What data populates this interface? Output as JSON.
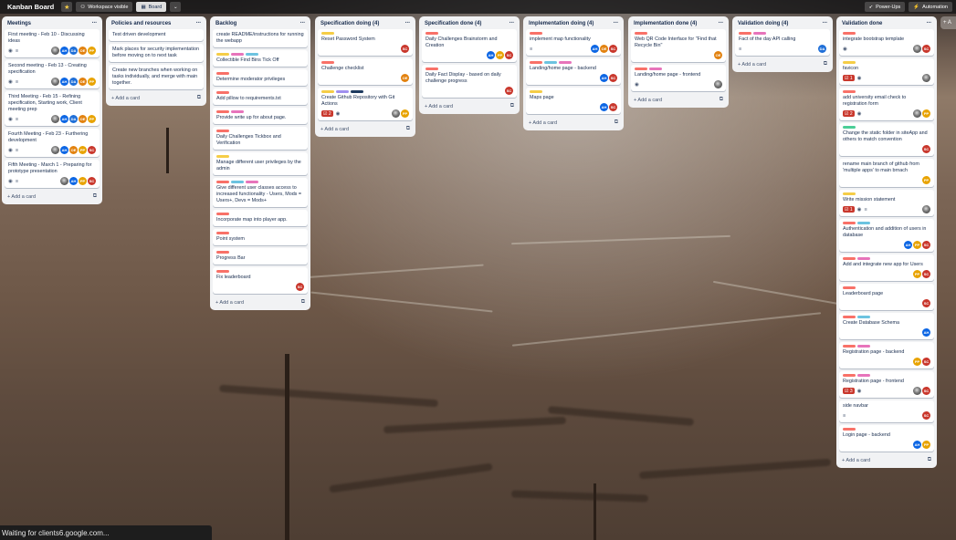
{
  "topbar": {
    "title": "Kanban Board",
    "visibility": "Workspace visible",
    "view": "Board",
    "powerups": "Power-Ups",
    "automation": "Automation"
  },
  "add_list": "+ A",
  "status_text": "Waiting for clients6.google.com...",
  "add_card_label": "+ Add a card",
  "lists": [
    {
      "title": "Meetings",
      "cards": [
        {
          "title": "First meeting - Feb 10 - Discussing ideas",
          "labels": [],
          "badges": [
            "eye",
            "desc"
          ],
          "avatars": [
            "photo",
            "AH",
            "DA",
            "OE",
            "PP"
          ]
        },
        {
          "title": "Second meeting - Feb 13 - Creating specification",
          "labels": [],
          "badges": [
            "eye",
            "desc"
          ],
          "avatars": [
            "photo",
            "AH",
            "DA",
            "OE",
            "PP"
          ]
        },
        {
          "title": "Third Meeting - Feb 15 - Refining specification, Starting work, Client meeting prep",
          "labels": [],
          "badges": [
            "eye",
            "desc"
          ],
          "avatars": [
            "photo",
            "AH",
            "DA",
            "OE",
            "PP"
          ]
        },
        {
          "title": "Fourth Meeting - Feb 23 - Furthering development",
          "labels": [],
          "badges": [
            "eye",
            "desc"
          ],
          "avatars": [
            "photo",
            "AH",
            "OE",
            "PP",
            "SC"
          ]
        },
        {
          "title": "Fifth Meeting - March 1 - Preparing for prototype presentation",
          "labels": [],
          "badges": [
            "eye",
            "desc"
          ],
          "avatars": [
            "photo",
            "AH",
            "PP",
            "SC"
          ]
        }
      ]
    },
    {
      "title": "Policies and resources",
      "cards": [
        {
          "title": "Test driven development",
          "labels": [],
          "badges": [],
          "avatars": []
        },
        {
          "title": "Mark places for security implementation before moving on to next task",
          "labels": [],
          "badges": [],
          "avatars": []
        },
        {
          "title": "Create new branches when working on tasks individually, and merge with main together.",
          "labels": [],
          "badges": [],
          "avatars": []
        }
      ]
    },
    {
      "title": "Backlog",
      "cards": [
        {
          "title": "create README/instructions for running the webapp",
          "labels": [],
          "badges": [],
          "avatars": []
        },
        {
          "title": "Collectible Find Bins Tick Off",
          "labels": [
            "yellow",
            "pink",
            "cyan"
          ],
          "badges": [],
          "avatars": []
        },
        {
          "title": "Determine moderator privileges",
          "labels": [
            "orange"
          ],
          "badges": [],
          "avatars": []
        },
        {
          "title": "Add pillow to requirements.txt",
          "labels": [
            "orange"
          ],
          "badges": [],
          "avatars": []
        },
        {
          "title": "Provide write up for about page.",
          "labels": [
            "orange",
            "pink"
          ],
          "badges": [],
          "avatars": []
        },
        {
          "title": "Daily Challenges Tickbox and Verification",
          "labels": [
            "orange"
          ],
          "badges": [],
          "avatars": []
        },
        {
          "title": "Manage different user privileges by the admin",
          "labels": [
            "yellow"
          ],
          "badges": [],
          "avatars": []
        },
        {
          "title": "Give different user classes access to increased functionality - Users, Mods = Users+, Devs = Mods+",
          "labels": [
            "orange",
            "cyan",
            "pink"
          ],
          "badges": [],
          "avatars": []
        },
        {
          "title": "Incorporate map into player app.",
          "labels": [
            "orange"
          ],
          "badges": [],
          "avatars": []
        },
        {
          "title": "Point system",
          "labels": [
            "orange"
          ],
          "badges": [],
          "avatars": []
        },
        {
          "title": "Progress Bar",
          "labels": [
            "orange"
          ],
          "badges": [],
          "avatars": []
        },
        {
          "title": "Fix leaderboard",
          "labels": [
            "orange"
          ],
          "badges": [],
          "avatars": [
            "SC"
          ]
        }
      ]
    },
    {
      "title": "Specification doing (4)",
      "cards": [
        {
          "title": "Reset Password System",
          "labels": [
            "yellow"
          ],
          "badges": [],
          "avatars": [
            "SC"
          ]
        },
        {
          "title": "Challenge checklist",
          "labels": [
            "orange"
          ],
          "badges": [],
          "avatars": [
            "OE"
          ]
        },
        {
          "title": "Create Github Repository with Git Actions",
          "labels": [
            "yellow",
            "purple",
            "navy"
          ],
          "badges": [
            "count:2",
            "eye"
          ],
          "avatars": [
            "photo",
            "PP"
          ]
        }
      ]
    },
    {
      "title": "Specification done (4)",
      "cards": [
        {
          "title": "Daily Challenges Brainstorm and Creation",
          "labels": [
            "orange"
          ],
          "badges": [],
          "avatars": [
            "AH",
            "PP",
            "SC"
          ]
        },
        {
          "title": "Daily Fact Display - based on daily challenge progress",
          "labels": [
            "orange"
          ],
          "badges": [],
          "avatars": [
            "SC"
          ]
        }
      ]
    },
    {
      "title": "Implementation doing (4)",
      "cards": [
        {
          "title": "implement map functionality",
          "labels": [
            "orange"
          ],
          "badges": [
            "desc"
          ],
          "avatars": [
            "AH",
            "OE",
            "SC"
          ]
        },
        {
          "title": "Landing/home page - backend",
          "labels": [
            "orange",
            "cyan",
            "pink"
          ],
          "badges": [],
          "avatars": [
            "AH",
            "SC"
          ]
        },
        {
          "title": "Maps page",
          "labels": [
            "yellow"
          ],
          "badges": [],
          "avatars": [
            "AH",
            "SC"
          ]
        }
      ]
    },
    {
      "title": "Implementation done (4)",
      "cards": [
        {
          "title": "Web QR Code Interface for \"Find that Recycle Bin\"",
          "labels": [
            "orange"
          ],
          "badges": [],
          "avatars": [
            "OE"
          ]
        },
        {
          "title": "Landing/home page - frontend",
          "labels": [
            "orange",
            "pink"
          ],
          "badges": [
            "eye"
          ],
          "avatars": [
            "photo"
          ]
        }
      ]
    },
    {
      "title": "Validation doing (4)",
      "cards": [
        {
          "title": "Fact of the day API calling",
          "labels": [
            "orange",
            "pink"
          ],
          "badges": [
            "desc"
          ],
          "avatars": [
            "DA"
          ]
        }
      ]
    },
    {
      "title": "Validation done",
      "cards": [
        {
          "title": "integrate bootstrap template",
          "labels": [
            "orange"
          ],
          "badges": [
            "eye"
          ],
          "avatars": [
            "photo",
            "SC"
          ]
        },
        {
          "title": "favicon",
          "labels": [
            "yellow"
          ],
          "badges": [
            "count:1",
            "eye"
          ],
          "avatars": [
            "photo"
          ]
        },
        {
          "title": "add university email check to registration form",
          "labels": [
            "orange"
          ],
          "badges": [
            "count:2",
            "eye"
          ],
          "avatars": [
            "photo",
            "PP"
          ]
        },
        {
          "title": "Change the static folder in siteApp and others to match convention",
          "labels": [
            "green"
          ],
          "badges": [],
          "avatars": [
            "SC"
          ]
        },
        {
          "title": "rename main branch of github from 'multiple apps' to main brnach",
          "labels": [],
          "badges": [],
          "avatars": [
            "PP"
          ]
        },
        {
          "title": "Write mission statement",
          "labels": [
            "yellow"
          ],
          "badges": [
            "count:1",
            "eye",
            "desc"
          ],
          "avatars": [
            "photo"
          ]
        },
        {
          "title": "Authentication and addition of users in database",
          "labels": [
            "orange",
            "cyan"
          ],
          "badges": [],
          "avatars": [
            "AH",
            "PP",
            "SC"
          ]
        },
        {
          "title": "Add and integrate new app for Users",
          "labels": [
            "orange",
            "pink"
          ],
          "badges": [],
          "avatars": [
            "PP",
            "SC"
          ]
        },
        {
          "title": "Leaderboard page",
          "labels": [
            "orange"
          ],
          "badges": [],
          "avatars": [
            "SC"
          ]
        },
        {
          "title": "Create Database Schema",
          "labels": [
            "orange",
            "cyan"
          ],
          "badges": [],
          "avatars": [
            "AH"
          ]
        },
        {
          "title": "Registration page - backend",
          "labels": [
            "orange",
            "pink"
          ],
          "badges": [],
          "avatars": [
            "PP",
            "SC"
          ]
        },
        {
          "title": "Registration page - frontend",
          "labels": [
            "orange",
            "pink"
          ],
          "badges": [
            "count:3",
            "eye"
          ],
          "avatars": [
            "photo",
            "SC"
          ]
        },
        {
          "title": "side navbar",
          "labels": [],
          "badges": [
            "desc"
          ],
          "avatars": [
            "SC"
          ]
        },
        {
          "title": "Login page - backend",
          "labels": [
            "orange"
          ],
          "badges": [],
          "avatars": [
            "AH",
            "PP"
          ]
        }
      ]
    }
  ]
}
